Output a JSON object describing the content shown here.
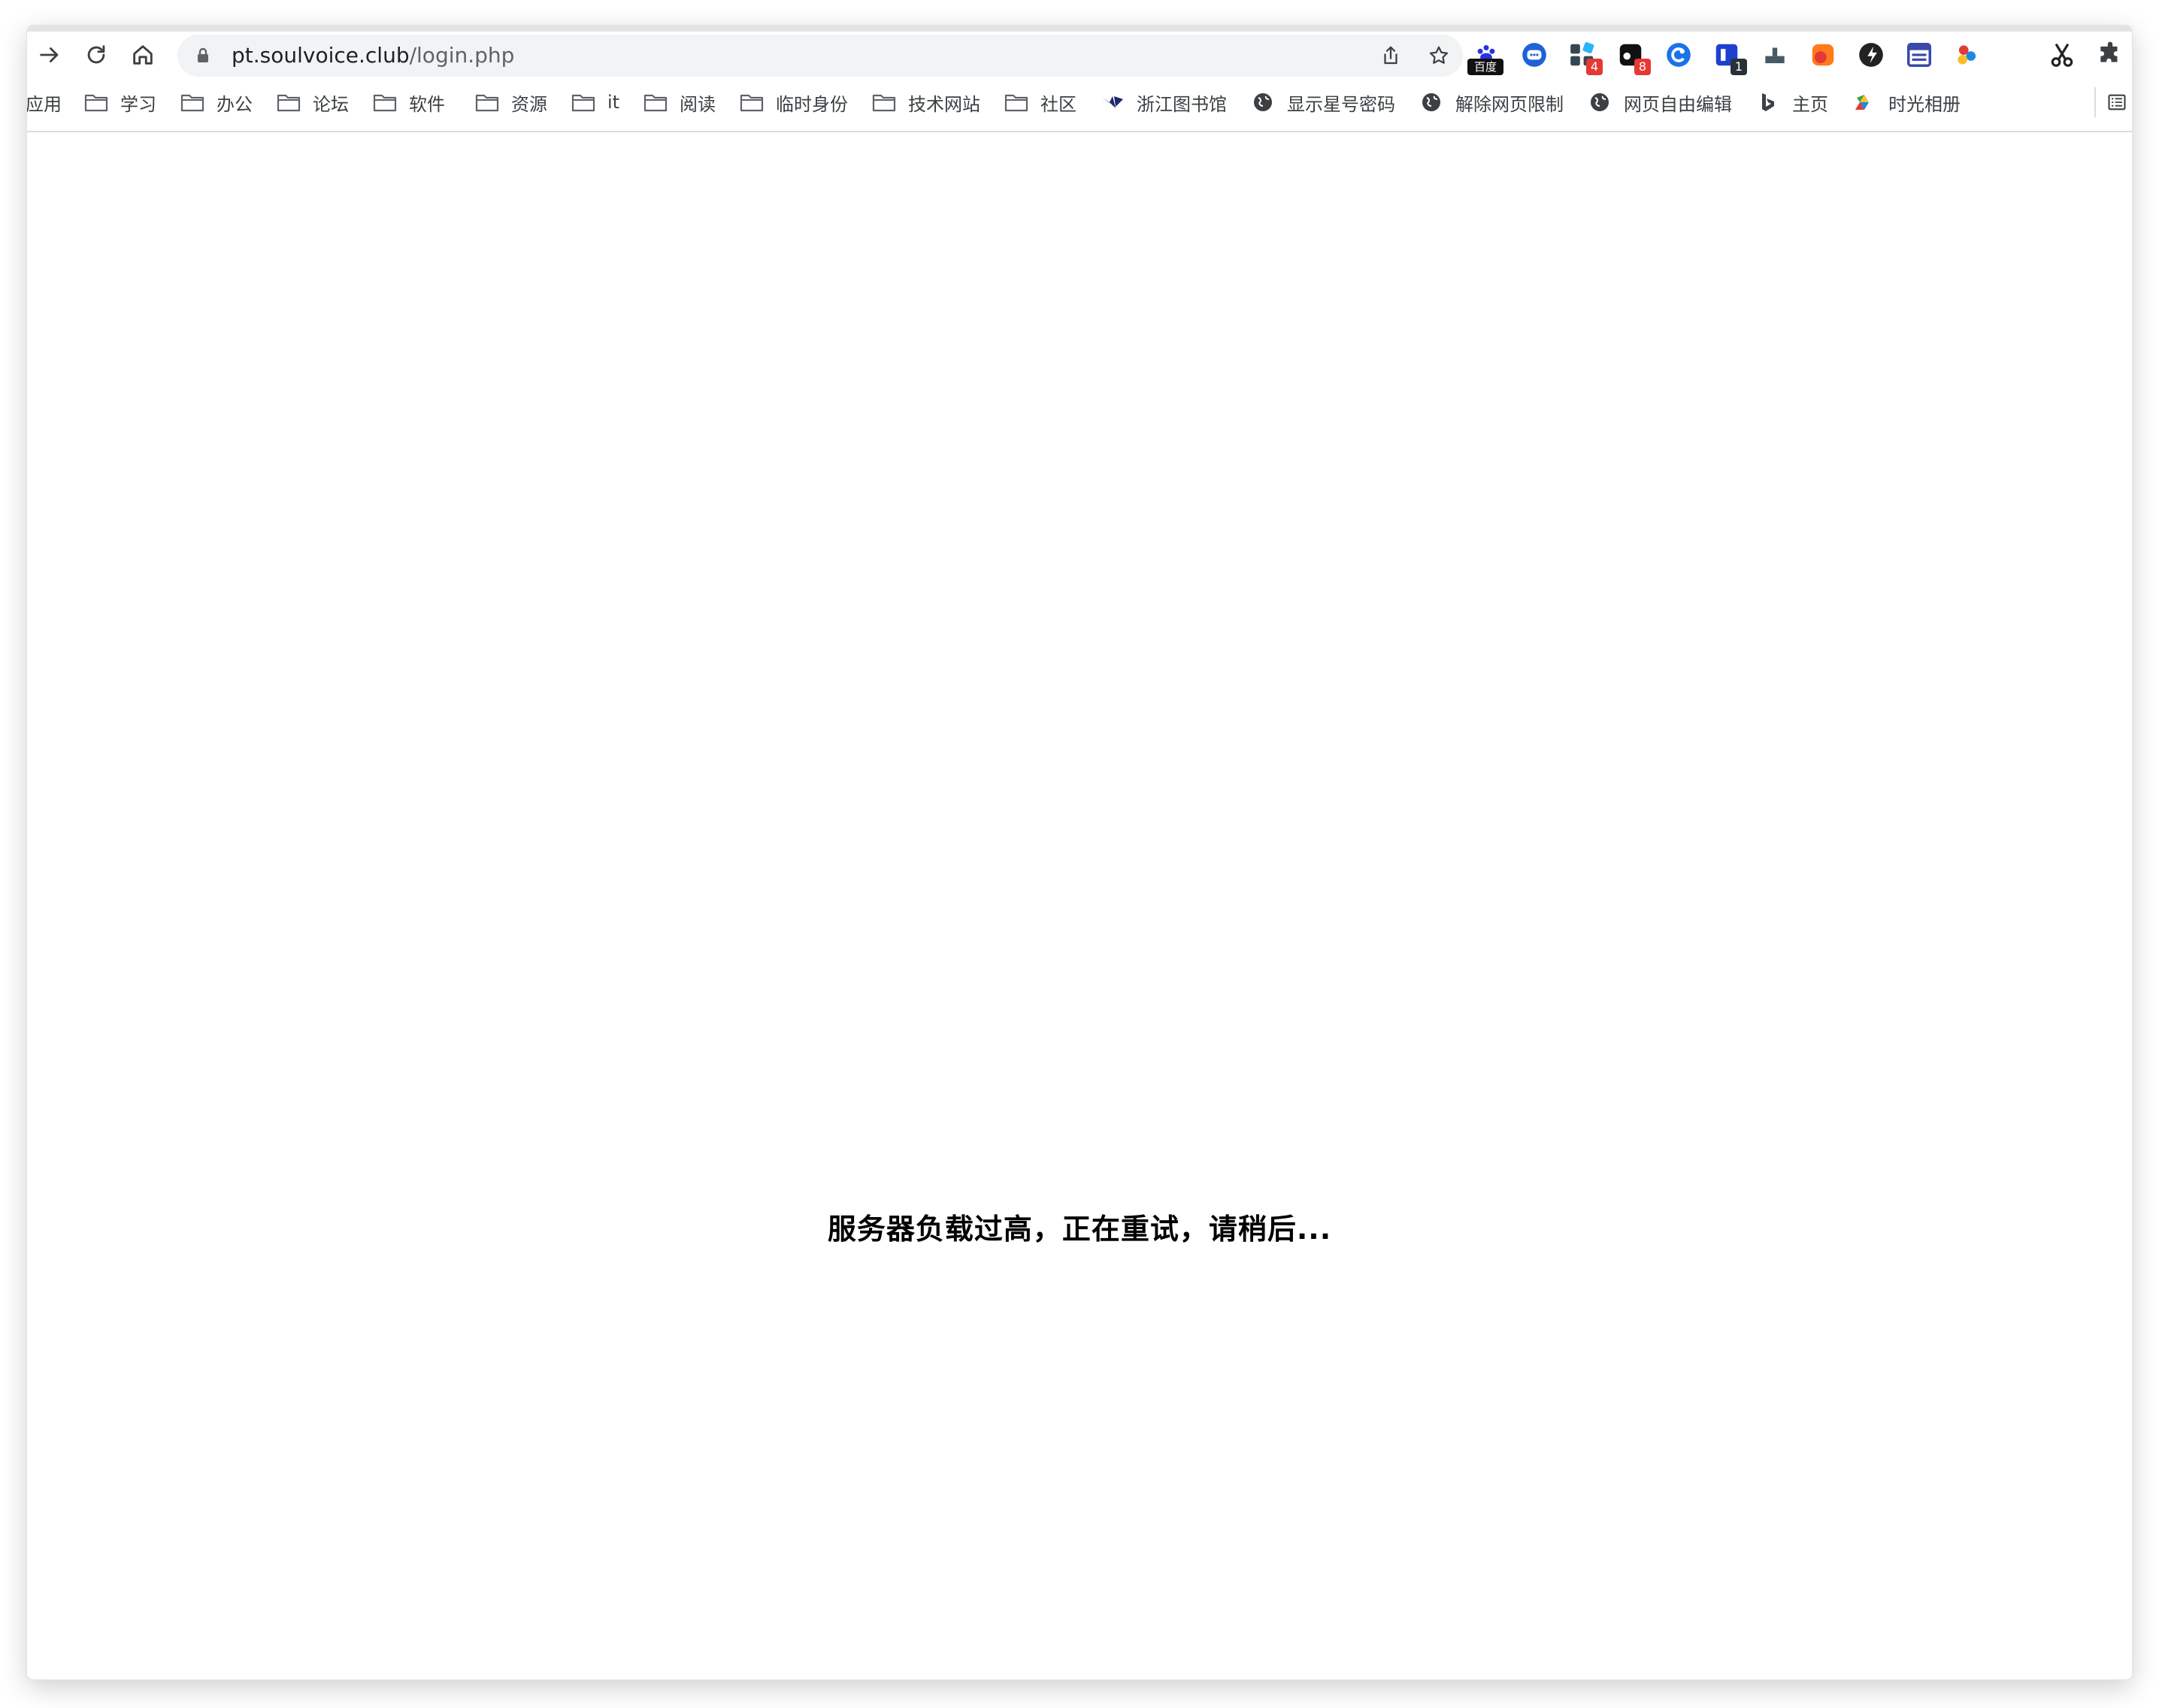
{
  "browser": {
    "address_bar": {
      "host": "pt.soulvoice.club",
      "path": "/login.php"
    },
    "nav": {
      "forward_icon": "arrow-right-icon",
      "reload_icon": "reload-icon",
      "home_icon": "home-icon"
    },
    "extensions": [
      {
        "name": "baidu",
        "label": "百度"
      },
      {
        "name": "chat-bubble"
      },
      {
        "name": "apps-grid",
        "badge": "4",
        "badge_color": "#e53935"
      },
      {
        "name": "black-square",
        "badge": "8",
        "badge_color": "#e53935"
      },
      {
        "name": "blue-circle"
      },
      {
        "name": "blue-tab",
        "badge": "1",
        "badge_color": "#263238"
      },
      {
        "name": "upload-tray"
      },
      {
        "name": "red-orange"
      },
      {
        "name": "dark-shield"
      },
      {
        "name": "window-frame"
      },
      {
        "name": "color-dots"
      },
      {
        "name": "scissors"
      },
      {
        "name": "puzzle-piece"
      }
    ]
  },
  "bookmarks": [
    {
      "label": "应用",
      "icon": "none"
    },
    {
      "label": "学习",
      "icon": "folder-icon"
    },
    {
      "label": "办公",
      "icon": "folder-icon"
    },
    {
      "label": "论坛",
      "icon": "folder-icon"
    },
    {
      "label": "软件",
      "icon": "folder-icon"
    },
    {
      "label": "资源",
      "icon": "folder-icon"
    },
    {
      "label": "it",
      "icon": "folder-icon"
    },
    {
      "label": "阅读",
      "icon": "folder-icon"
    },
    {
      "label": "临时身份",
      "icon": "folder-icon"
    },
    {
      "label": "技术网站",
      "icon": "folder-icon"
    },
    {
      "label": "社区",
      "icon": "folder-icon"
    },
    {
      "label": "浙江图书馆",
      "icon": "library-logo-icon"
    },
    {
      "label": "显示星号密码",
      "icon": "globe-icon"
    },
    {
      "label": "解除网页限制",
      "icon": "globe-icon"
    },
    {
      "label": "网页自由编辑",
      "icon": "globe-icon"
    },
    {
      "label": "主页",
      "icon": "bing-icon"
    },
    {
      "label": "时光相册",
      "icon": "photos-icon"
    }
  ],
  "page": {
    "message": "服务器负载过高，正在重试，请稍后..."
  },
  "colors": {
    "accent_blue": "#1a73e8",
    "omnibox_bg": "#f1f3f4",
    "badge_red": "#e53935"
  }
}
